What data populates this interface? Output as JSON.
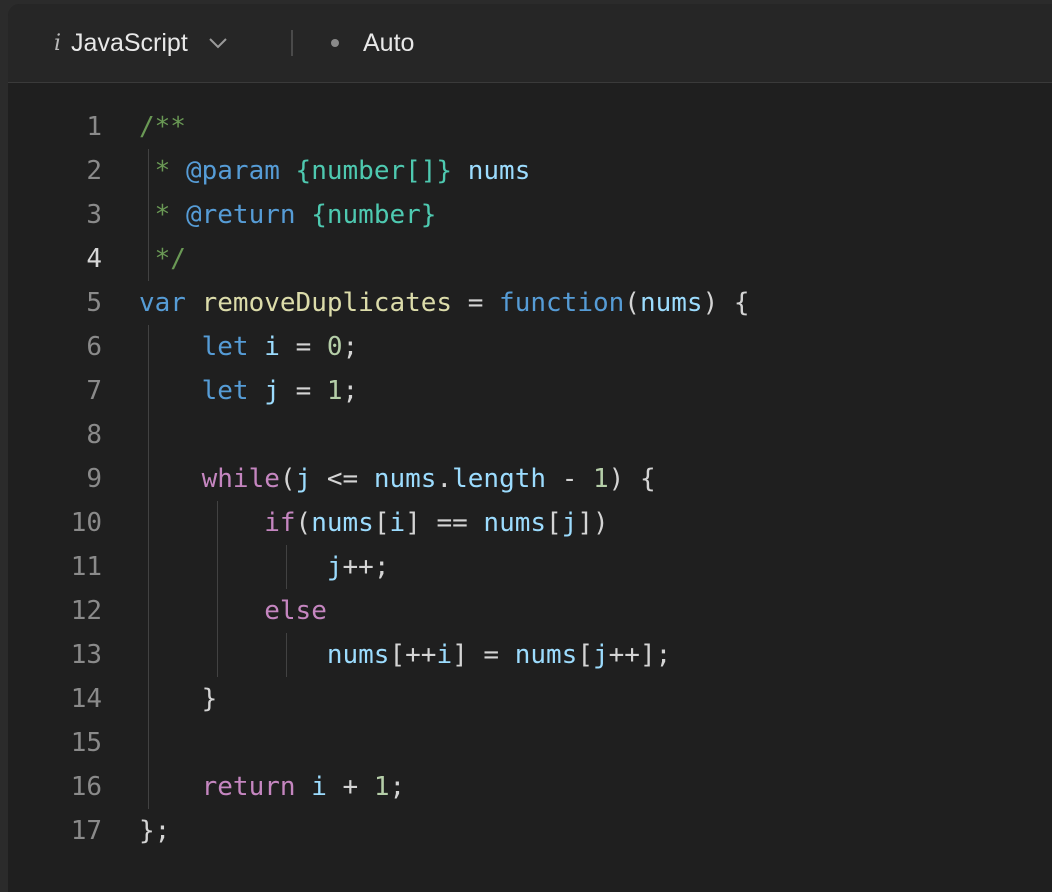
{
  "toolbar": {
    "language_icon": "i",
    "language_label": "JavaScript",
    "mode_label": "Auto"
  },
  "editor": {
    "active_line": 4,
    "line_numbers": [
      "1",
      "2",
      "3",
      "4",
      "5",
      "6",
      "7",
      "8",
      "9",
      "10",
      "11",
      "12",
      "13",
      "14",
      "15",
      "16",
      "17"
    ],
    "lines": [
      "/**",
      " * @param {number[]} nums",
      " * @return {number}",
      " */",
      "var removeDuplicates = function(nums) {",
      "    let i = 0;",
      "    let j = 1;",
      "",
      "    while(j <= nums.length - 1) {",
      "        if(nums[i] == nums[j])",
      "            j++;",
      "        else",
      "            nums[++i] = nums[j++];",
      "    }",
      "",
      "    return i + 1;",
      "};"
    ]
  },
  "syntax_colors": {
    "comment": "#6a9955",
    "keyword": "#569cd6",
    "control": "#c586c0",
    "function": "#dcdcaa",
    "variable": "#9cdcfe",
    "number": "#b5cea8",
    "type": "#4ec9b0",
    "punctuation": "#d4d4d4",
    "background": "#1f1f1f"
  }
}
